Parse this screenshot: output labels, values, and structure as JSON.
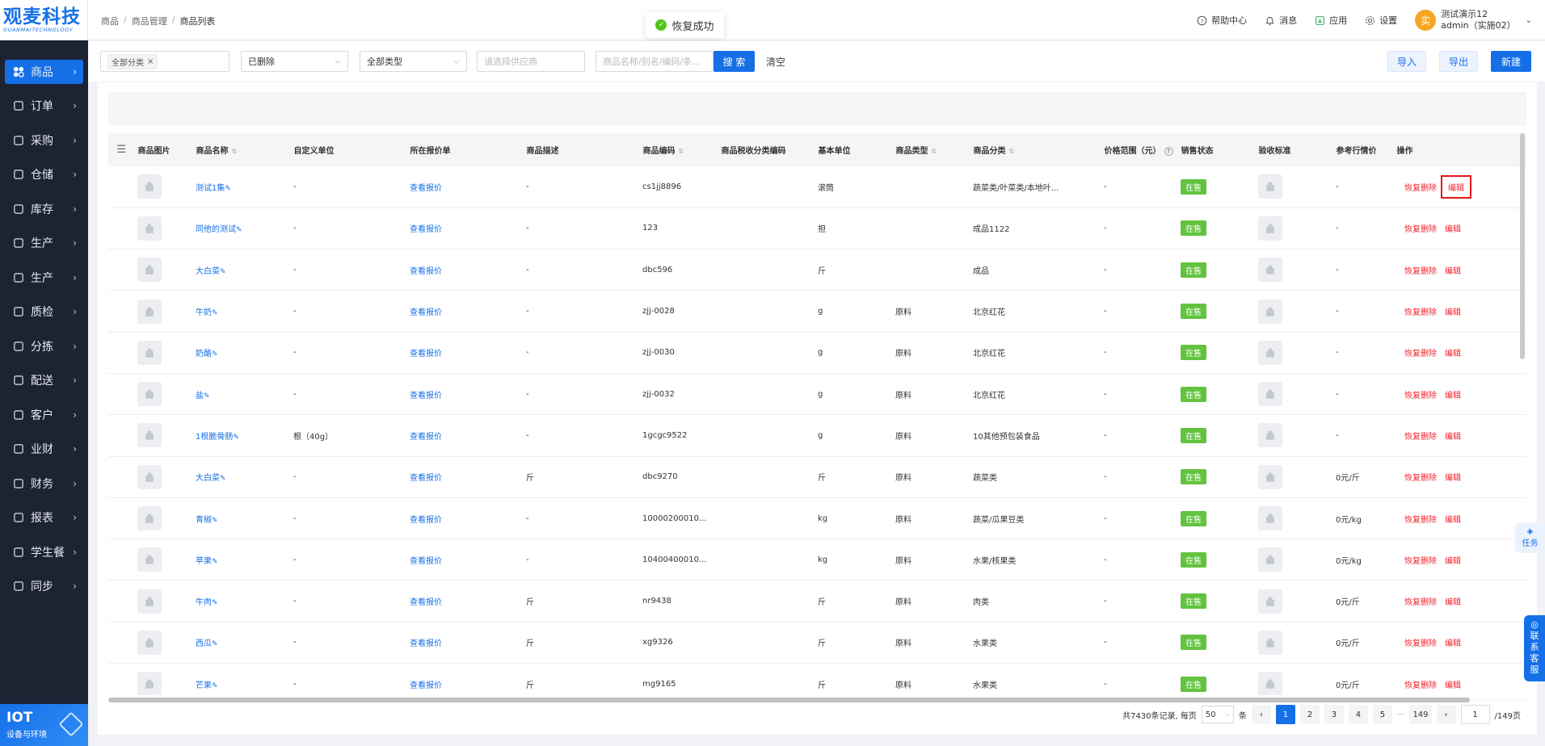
{
  "sidebar": {
    "logo": {
      "main": "观麦科技",
      "sub": "GUANMAITECHNOLOGY"
    },
    "items": [
      {
        "label": "商品",
        "icon": "goods-icon",
        "active": true
      },
      {
        "label": "订单",
        "icon": "order-icon"
      },
      {
        "label": "采购",
        "icon": "purchase-icon"
      },
      {
        "label": "仓储",
        "icon": "warehouse-icon"
      },
      {
        "label": "库存",
        "icon": "inventory-icon"
      },
      {
        "label": "生产",
        "icon": "production-icon"
      },
      {
        "label": "生产",
        "icon": "production-icon"
      },
      {
        "label": "质检",
        "icon": "quality-check-icon"
      },
      {
        "label": "分拣",
        "icon": "sorting-icon"
      },
      {
        "label": "配送",
        "icon": "delivery-truck-icon"
      },
      {
        "label": "客户",
        "icon": "customer-icon"
      },
      {
        "label": "业财",
        "icon": "business-finance-icon"
      },
      {
        "label": "财务",
        "icon": "finance-icon"
      },
      {
        "label": "报表",
        "icon": "report-icon"
      },
      {
        "label": "学生餐",
        "icon": "student-meal-icon"
      },
      {
        "label": "同步",
        "icon": "sync-icon"
      }
    ],
    "iot": {
      "title": "IOT",
      "subtitle": "设备与环境"
    }
  },
  "topbar": {
    "breadcrumb": [
      "商品",
      "商品管理",
      "商品列表"
    ],
    "toast": "恢复成功",
    "actions": {
      "help": "帮助中心",
      "messages": "消息",
      "apps": "应用",
      "settings": "设置"
    },
    "user": {
      "avatar": "实",
      "name": "测试演示12",
      "account": "admin（实施02）"
    }
  },
  "filters": {
    "category_tag": "全部分类",
    "status_select": "已删除",
    "type_select": "全部类型",
    "supplier_placeholder": "请选择供应商",
    "search_placeholder": "商品名称/别名/编码/条...",
    "search_button": "搜 索",
    "clear_button": "清空",
    "import_button": "导入",
    "export_button": "导出",
    "new_button": "新建"
  },
  "table": {
    "columns": [
      "商品图片",
      "商品名称",
      "自定义单位",
      "所在报价单",
      "商品描述",
      "商品编码",
      "商品税收分类编码",
      "基本单位",
      "商品类型",
      "商品分类",
      "价格范围（元）",
      "销售状态",
      "验收标准",
      "参考行情价",
      "操作"
    ],
    "quote_link": "查看报价",
    "status_label": "在售",
    "action_restore": "恢复删除",
    "action_edit": "编辑",
    "rows": [
      {
        "name": "测试1集",
        "custom_unit": "-",
        "desc": "-",
        "code": "cs1jj8896",
        "tax": "",
        "unit": "滚筒",
        "type": "",
        "category": "蔬菜类/叶菜类/本地叶...",
        "price_range": "-",
        "ref_price": "-"
      },
      {
        "name": "同他的测试",
        "custom_unit": "-",
        "desc": "-",
        "code": "123",
        "tax": "",
        "unit": "担",
        "type": "",
        "category": "成品1122",
        "price_range": "-",
        "ref_price": "-"
      },
      {
        "name": "大白菜",
        "custom_unit": "-",
        "desc": "-",
        "code": "dbc596",
        "tax": "",
        "unit": "斤",
        "type": "",
        "category": "成品",
        "price_range": "-",
        "ref_price": "-"
      },
      {
        "name": "牛奶",
        "custom_unit": "-",
        "desc": "-",
        "code": "zjj-0028",
        "tax": "",
        "unit": "g",
        "type": "原料",
        "category": "北京红花",
        "price_range": "-",
        "ref_price": "-"
      },
      {
        "name": "奶酪",
        "custom_unit": "-",
        "desc": "-",
        "code": "zjj-0030",
        "tax": "",
        "unit": "g",
        "type": "原料",
        "category": "北京红花",
        "price_range": "-",
        "ref_price": "-"
      },
      {
        "name": "盐",
        "custom_unit": "-",
        "desc": "-",
        "code": "zjj-0032",
        "tax": "",
        "unit": "g",
        "type": "原料",
        "category": "北京红花",
        "price_range": "-",
        "ref_price": "-"
      },
      {
        "name": "1根脆骨肠",
        "custom_unit": "根（40g）",
        "desc": "-",
        "code": "1gcgc9522",
        "tax": "",
        "unit": "g",
        "type": "原料",
        "category": "10其他预包装食品",
        "price_range": "-",
        "ref_price": "-"
      },
      {
        "name": "大白菜",
        "custom_unit": "-",
        "desc": "斤",
        "code": "dbc9270",
        "tax": "",
        "unit": "斤",
        "type": "原料",
        "category": "蔬菜类",
        "price_range": "-",
        "ref_price": "0元/斤"
      },
      {
        "name": "青椒",
        "custom_unit": "-",
        "desc": "-",
        "code": "10000200010...",
        "tax": "",
        "unit": "kg",
        "type": "原料",
        "category": "蔬菜/瓜果豆类",
        "price_range": "-",
        "ref_price": "0元/kg"
      },
      {
        "name": "苹果",
        "custom_unit": "-",
        "desc": "-",
        "code": "10400400010...",
        "tax": "",
        "unit": "kg",
        "type": "原料",
        "category": "水果/核果类",
        "price_range": "-",
        "ref_price": "0元/kg"
      },
      {
        "name": "牛肉",
        "custom_unit": "-",
        "desc": "斤",
        "code": "nr9438",
        "tax": "",
        "unit": "斤",
        "type": "原料",
        "category": "肉类",
        "price_range": "-",
        "ref_price": "0元/斤"
      },
      {
        "name": "西瓜",
        "custom_unit": "-",
        "desc": "斤",
        "code": "xg9326",
        "tax": "",
        "unit": "斤",
        "type": "原料",
        "category": "水果类",
        "price_range": "-",
        "ref_price": "0元/斤"
      },
      {
        "name": "芒果",
        "custom_unit": "-",
        "desc": "斤",
        "code": "mg9165",
        "tax": "",
        "unit": "斤",
        "type": "原料",
        "category": "水果类",
        "price_range": "-",
        "ref_price": "0元/斤"
      }
    ]
  },
  "pagination": {
    "total_text": "共7430条记录, 每页",
    "page_size": "50",
    "unit": "条",
    "prev": "‹",
    "pages": [
      "1",
      "2",
      "3",
      "4",
      "5",
      "···",
      "149"
    ],
    "current": "1",
    "next": "›",
    "jump_value": "1",
    "total_pages": "/149页"
  },
  "widgets": {
    "task": "任务",
    "service": [
      "联",
      "系",
      "客",
      "服"
    ]
  },
  "colors": {
    "primary": "#1570e8",
    "sidebar_bg": "#1c2333",
    "danger": "#f5222d",
    "success": "#63c340"
  }
}
